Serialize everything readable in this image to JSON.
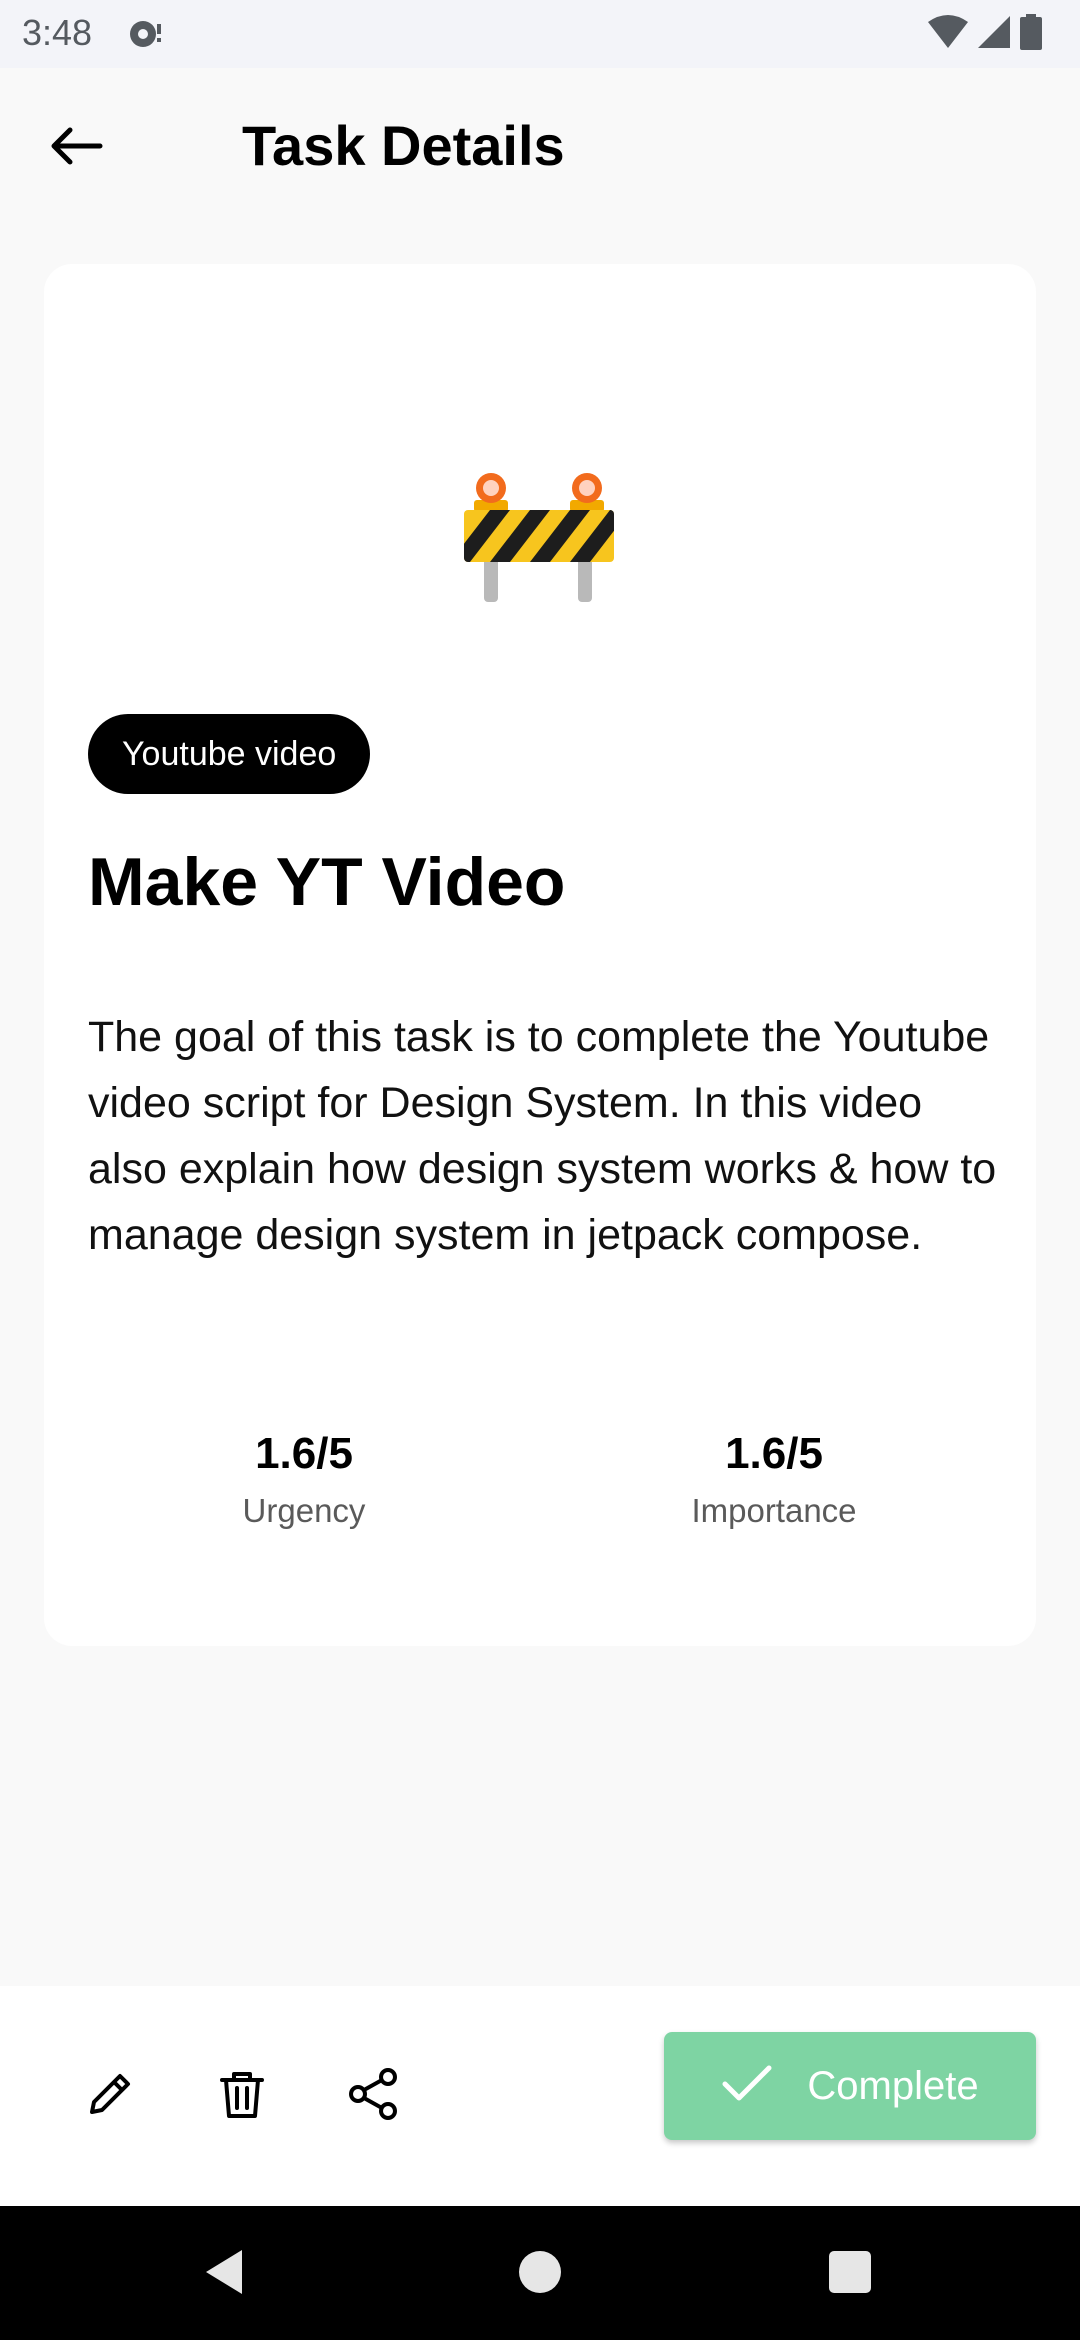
{
  "status_bar": {
    "time": "3:48"
  },
  "header": {
    "title": "Task Details",
    "back_icon": "arrow-left-icon"
  },
  "task": {
    "emoji": "construction-barrier-icon",
    "category": "Youtube video",
    "title": "Make YT Video",
    "description": "The goal of this task is to complete the Youtube video script for Design System. In this video also explain how design system works & how to manage design system in jetpack compose.",
    "metrics": [
      {
        "value": "1.6/5",
        "label": "Urgency"
      },
      {
        "value": "1.6/5",
        "label": "Importance"
      }
    ]
  },
  "actions": {
    "edit_icon": "pencil-icon",
    "delete_icon": "trash-icon",
    "share_icon": "share-icon",
    "complete_label": "Complete",
    "complete_color": "#7ed4a3"
  }
}
